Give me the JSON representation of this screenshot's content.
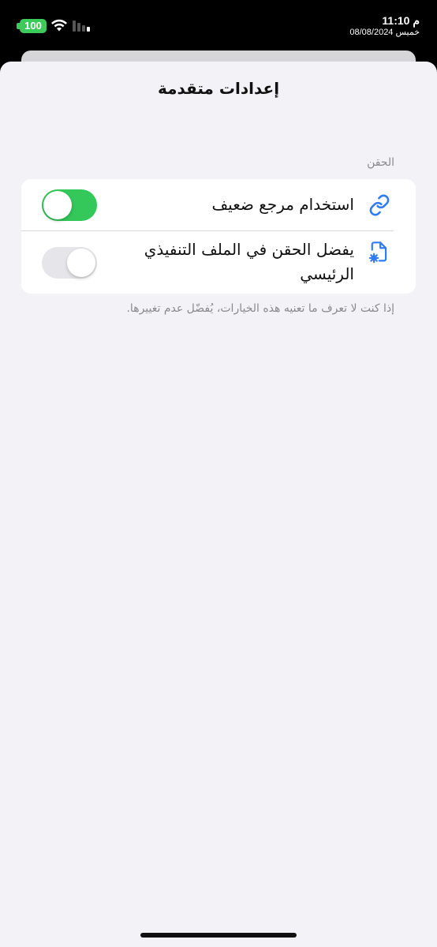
{
  "status_bar": {
    "battery": "100",
    "time": "11:10 م",
    "date": "خميس 08/08/2024",
    "accent": "#3ec95b"
  },
  "sheet": {
    "title": "إعدادات متقدمة",
    "section_header": "الحقن",
    "rows": [
      {
        "label": "استخدام مرجع ضعيف",
        "icon": "link-icon",
        "toggle_on": true
      },
      {
        "label": "يفضل الحقن في الملف التنفيذي الرئيسي",
        "icon": "file-gear-icon",
        "toggle_on": false
      }
    ],
    "footnote": "إذا كنت لا تعرف ما تعنيه هذه الخيارات، يُفضّل عدم تغييرها."
  },
  "colors": {
    "toggle_on": "#34c759",
    "icon_blue": "#2f7cf6",
    "background": "#f2f2f7"
  }
}
